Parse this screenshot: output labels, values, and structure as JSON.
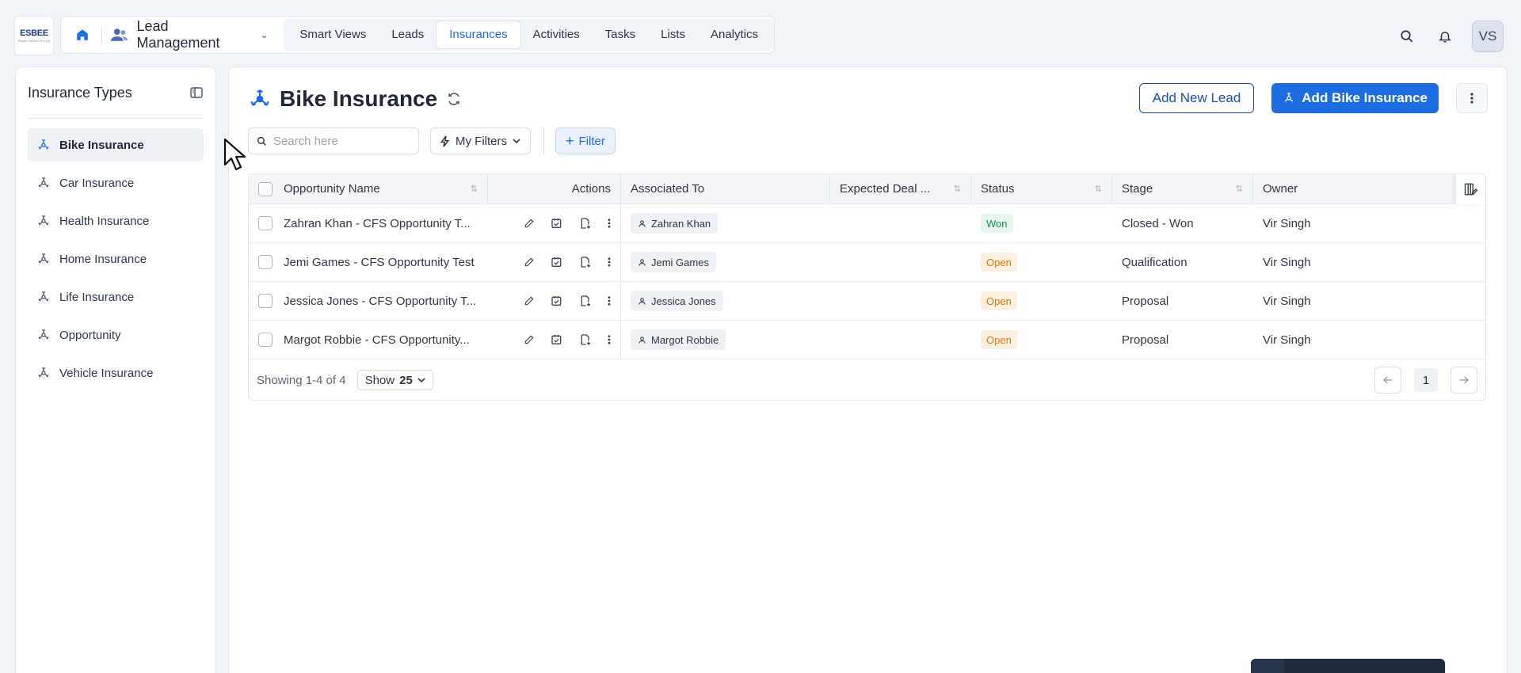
{
  "app": {
    "logo_text": "ESBEE",
    "logo_subtext": "Power Solution Pvt Ltd",
    "module": "Lead Management",
    "tabs": [
      "Smart Views",
      "Leads",
      "Insurances",
      "Activities",
      "Tasks",
      "Lists",
      "Analytics"
    ],
    "active_tab": "Insurances",
    "user_initials": "VS"
  },
  "sidebar": {
    "title": "Insurance Types",
    "items": [
      {
        "label": "Bike Insurance",
        "active": true
      },
      {
        "label": "Car Insurance"
      },
      {
        "label": "Health Insurance"
      },
      {
        "label": "Home Insurance"
      },
      {
        "label": "Life Insurance"
      },
      {
        "label": "Opportunity"
      },
      {
        "label": "Vehicle Insurance"
      }
    ]
  },
  "page": {
    "title": "Bike Insurance",
    "add_lead_label": "Add New Lead",
    "add_primary_label": "Add Bike Insurance"
  },
  "toolbar": {
    "search_placeholder": "Search here",
    "my_filters_label": "My Filters",
    "filter_label": "Filter"
  },
  "table": {
    "columns": {
      "name": "Opportunity Name",
      "actions": "Actions",
      "associated": "Associated To",
      "expected": "Expected Deal ...",
      "status": "Status",
      "stage": "Stage",
      "owner": "Owner"
    },
    "rows": [
      {
        "name": "Zahran Khan - CFS Opportunity T...",
        "associated": "Zahran Khan",
        "status": "Won",
        "stage": "Closed - Won",
        "owner": "Vir Singh"
      },
      {
        "name": "Jemi Games - CFS Opportunity Test",
        "associated": "Jemi Games",
        "status": "Open",
        "stage": "Qualification",
        "owner": "Vir Singh"
      },
      {
        "name": "Jessica Jones - CFS Opportunity T...",
        "associated": "Jessica Jones",
        "status": "Open",
        "stage": "Proposal",
        "owner": "Vir Singh"
      },
      {
        "name": "Margot Robbie - CFS Opportunity...",
        "associated": "Margot Robbie",
        "status": "Open",
        "stage": "Proposal",
        "owner": "Vir Singh"
      }
    ]
  },
  "pagination": {
    "showing": "Showing 1-4 of 4",
    "show_prefix": "Show",
    "page_size": "25",
    "current_page": "1"
  },
  "colors": {
    "accent": "#1c6ee0",
    "won": "#1e8a4c",
    "open": "#d9760b"
  }
}
